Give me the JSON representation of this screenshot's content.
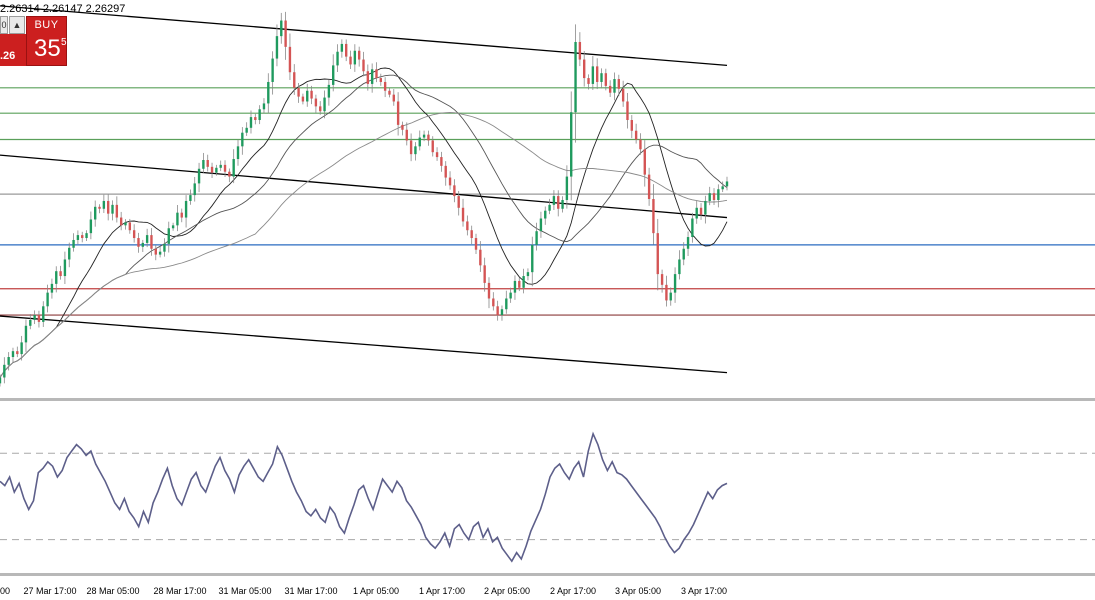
{
  "header": {
    "ohlc_text": "2.26314 2.26147 2.26297"
  },
  "trade_panel": {
    "buy_label": "BUY",
    "price_prefix": ".26",
    "price_main": "35",
    "price_superscript": "5",
    "lot_field_fragment": "0",
    "arrow_label": "▲",
    "accent_color": "#cc1f1f"
  },
  "time_axis": {
    "labels": [
      "00",
      "27 Mar 17:00",
      "28 Mar 05:00",
      "28 Mar 17:00",
      "31 Mar 05:00",
      "31 Mar 17:00",
      "1 Apr 05:00",
      "1 Apr 17:00",
      "2 Apr 05:00",
      "2 Apr 17:00",
      "3 Apr 05:00",
      "3 Apr 17:00"
    ]
  },
  "chart_data": [
    {
      "type": "candlestick",
      "title": "",
      "xlabel": "",
      "ylabel": "",
      "closes": [
        2.2415,
        2.2428,
        2.2436,
        2.2442,
        2.2439,
        2.2451,
        2.2468,
        2.2474,
        2.2479,
        2.2472,
        2.2488,
        2.2502,
        2.2511,
        2.2524,
        2.2519,
        2.2536,
        2.2548,
        2.2556,
        2.2561,
        2.2558,
        2.2563,
        2.2577,
        2.259,
        2.2588,
        2.2596,
        2.2583,
        2.2592,
        2.2579,
        2.2571,
        2.2574,
        2.2566,
        2.2558,
        2.2549,
        2.2553,
        2.2561,
        2.2547,
        2.2541,
        2.2544,
        2.2552,
        2.2568,
        2.2571,
        2.2584,
        2.2579,
        2.2596,
        2.2602,
        2.2614,
        2.2629,
        2.2638,
        2.2631,
        2.2625,
        2.263,
        2.2633,
        2.2626,
        2.2621,
        2.2639,
        2.2652,
        2.2666,
        2.2671,
        2.2682,
        2.2679,
        2.269,
        2.2696,
        2.2718,
        2.2742,
        2.2765,
        2.2781,
        2.2754,
        2.2728,
        2.2712,
        2.2703,
        2.2698,
        2.2709,
        2.2701,
        2.2693,
        2.2688,
        2.2702,
        2.2715,
        2.2735,
        2.2749,
        2.2757,
        2.2744,
        2.2736,
        2.275,
        2.2741,
        2.2729,
        2.2716,
        2.2731,
        2.2722,
        2.2718,
        2.2709,
        2.2705,
        2.2698,
        2.2674,
        2.2669,
        2.2658,
        2.2644,
        2.2652,
        2.2661,
        2.2664,
        2.2658,
        2.2646,
        2.2641,
        2.2632,
        2.262,
        2.2612,
        2.2601,
        2.2589,
        2.2575,
        2.2566,
        2.2558,
        2.2546,
        2.253,
        2.2512,
        2.2496,
        2.2488,
        2.2479,
        2.2485,
        2.2496,
        2.2502,
        2.2514,
        2.2507,
        2.2519,
        2.2523,
        2.2551,
        2.2565,
        2.2578,
        2.2586,
        2.2592,
        2.2601,
        2.2588,
        2.2597,
        2.2621,
        2.2687,
        2.2759,
        2.2741,
        2.2722,
        2.2716,
        2.2734,
        2.2718,
        2.2727,
        2.2714,
        2.2707,
        2.2721,
        2.2711,
        2.2698,
        2.2679,
        2.2668,
        2.2659,
        2.2649,
        2.2623,
        2.2598,
        2.2563,
        2.2521,
        2.251,
        2.2494,
        2.2502,
        2.2521,
        2.2536,
        2.2547,
        2.2559,
        2.2578,
        2.2589,
        2.2582,
        2.2596,
        2.2604,
        2.2597,
        2.2608,
        2.2611,
        2.2616
      ],
      "ylim": [
        2.2395,
        2.28
      ],
      "moving_averages": [
        {
          "period": 14,
          "color": "#222222"
        },
        {
          "period": 30,
          "color": "#555555"
        },
        {
          "period": 60,
          "color": "#8a8a8a"
        }
      ],
      "channel_lines": [
        {
          "x_start": 0,
          "y_start": 2.2796,
          "x_end": 168,
          "y_end": 2.2735,
          "color": "#000000"
        },
        {
          "x_start": 0,
          "y_start": 2.2643,
          "x_end": 168,
          "y_end": 2.2579,
          "color": "#000000"
        },
        {
          "x_start": 0,
          "y_start": 2.2478,
          "x_end": 168,
          "y_end": 2.242,
          "color": "#000000"
        }
      ],
      "horizontal_levels": [
        {
          "value": 2.2712,
          "color": "#5aa05a"
        },
        {
          "value": 2.2686,
          "color": "#5aa05a"
        },
        {
          "value": 2.2659,
          "color": "#5aa05a"
        },
        {
          "value": 2.2603,
          "color": "#9a9a9a"
        },
        {
          "value": 2.2551,
          "color": "#2a6bc0"
        },
        {
          "value": 2.2506,
          "color": "#c04040"
        },
        {
          "value": 2.2479,
          "color": "#8b3a3a"
        }
      ],
      "colors": {
        "up": "#1f9a5e",
        "down": "#d45454",
        "wick": "#888888"
      }
    },
    {
      "type": "line",
      "title": "",
      "xlabel": "",
      "ylabel": "",
      "values": [
        57,
        55,
        59,
        52,
        56,
        49,
        44,
        48,
        61,
        63,
        66,
        64,
        59,
        62,
        68,
        71,
        74,
        72,
        69,
        71,
        65,
        61,
        57,
        52,
        47,
        44,
        49,
        43,
        40,
        36,
        43,
        38,
        47,
        52,
        58,
        63,
        55,
        49,
        46,
        52,
        58,
        61,
        55,
        52,
        58,
        64,
        68,
        62,
        58,
        52,
        60,
        64,
        67,
        63,
        59,
        57,
        61,
        65,
        73,
        69,
        63,
        57,
        52,
        48,
        43,
        41,
        44,
        40,
        38,
        45,
        42,
        36,
        33,
        40,
        46,
        53,
        55,
        49,
        44,
        51,
        58,
        55,
        52,
        57,
        54,
        48,
        45,
        41,
        37,
        31,
        28,
        26,
        29,
        33,
        27,
        35,
        37,
        33,
        30,
        36,
        38,
        31,
        35,
        29,
        31,
        26,
        23,
        20,
        24,
        21,
        27,
        34,
        39,
        44,
        51,
        59,
        63,
        65,
        61,
        58,
        63,
        66,
        59,
        71,
        79,
        74,
        67,
        62,
        66,
        61,
        60,
        58,
        55,
        52,
        49,
        46,
        43,
        40,
        36,
        31,
        27,
        24,
        26,
        30,
        33,
        37,
        42,
        47,
        52,
        49,
        53,
        55,
        56
      ],
      "ylim": [
        15,
        90
      ],
      "reference_levels": [
        70,
        30
      ],
      "color": "#5d5f8a"
    }
  ]
}
